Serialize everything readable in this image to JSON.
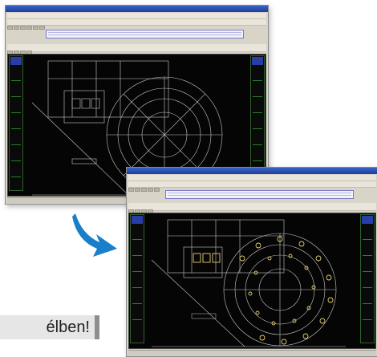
{
  "callout": {
    "text": "élben!"
  },
  "colors": {
    "arrow": "#1a7fc9",
    "cad_background": "#050505",
    "cad_lines": "#c9c9c9",
    "highlight": "#e8d070"
  }
}
